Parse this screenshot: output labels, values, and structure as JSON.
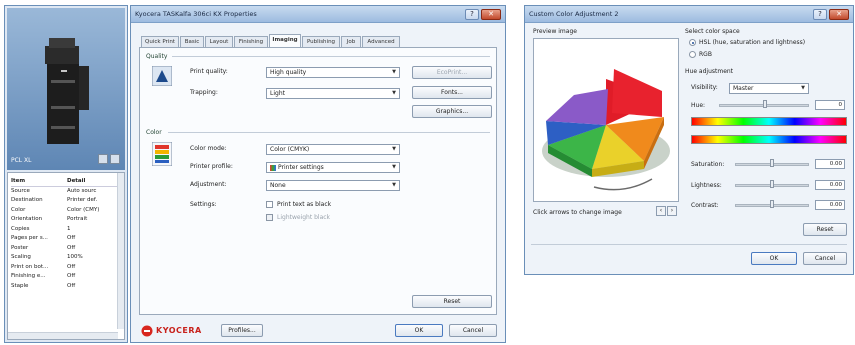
{
  "sidebar": {
    "preview_label": "PCL XL",
    "columns": [
      "Item",
      "Detail"
    ],
    "rows": [
      [
        "Source",
        "Auto sourc"
      ],
      [
        "Destination",
        "Printer def."
      ],
      [
        "Color",
        "Color (CMY)"
      ],
      [
        "Orientation",
        "Portrait"
      ],
      [
        "Copies",
        "1"
      ],
      [
        "Pages per s...",
        "Off"
      ],
      [
        "Poster",
        "Off"
      ],
      [
        "Scaling",
        "100%"
      ],
      [
        "Print on bot...",
        "Off"
      ],
      [
        "Finishing e...",
        "Off"
      ],
      [
        "Staple",
        "Off"
      ]
    ]
  },
  "main": {
    "title": "Kyocera TASKalfa 306ci KX Properties",
    "tabs": [
      "Quick Print",
      "Basic",
      "Layout",
      "Finishing",
      "Imaging",
      "Publishing",
      "Job",
      "Advanced"
    ],
    "active_tab": "Imaging",
    "quality_group": "Quality",
    "print_quality_label": "Print quality:",
    "print_quality_value": "High quality",
    "trapping_label": "Trapping:",
    "trapping_value": "Light",
    "eco_button": "EcoPrint...",
    "fonts_button": "Fonts...",
    "graphics_button": "Graphics...",
    "color_group": "Color",
    "color_mode_label": "Color mode:",
    "color_mode_value": "Color (CMYK)",
    "printer_profile_label": "Printer profile:",
    "printer_profile_value": "Printer settings",
    "adjustment_label": "Adjustment:",
    "adjustment_value": "None",
    "settings_label": "Settings:",
    "print_text_black": "Print text as black",
    "lightweight_label": "Lightweight black",
    "reset_button": "Reset",
    "brand": "KYOCERA",
    "profiles_button": "Profiles...",
    "ok_button": "OK",
    "cancel_button": "Cancel"
  },
  "custom": {
    "title": "Custom Color Adjustment 2",
    "preview_label": "Preview image",
    "click_hint": "Click arrows to change image",
    "color_space_label": "Select color space",
    "hsl_label": "HSL (hue, saturation and lightness)",
    "rgb_label": "RGB",
    "hue_adjust_label": "Hue adjustment",
    "visibility_label": "Visibility:",
    "visibility_value": "Master",
    "hue_label": "Hue:",
    "hue_value": "0",
    "saturation_label": "Saturation:",
    "saturation_value": "0.00",
    "lightness_label": "Lightness:",
    "lightness_value": "0.00",
    "contrast_label": "Contrast:",
    "contrast_value": "0.00",
    "reset_button": "Reset",
    "ok_button": "OK",
    "cancel_button": "Cancel"
  }
}
